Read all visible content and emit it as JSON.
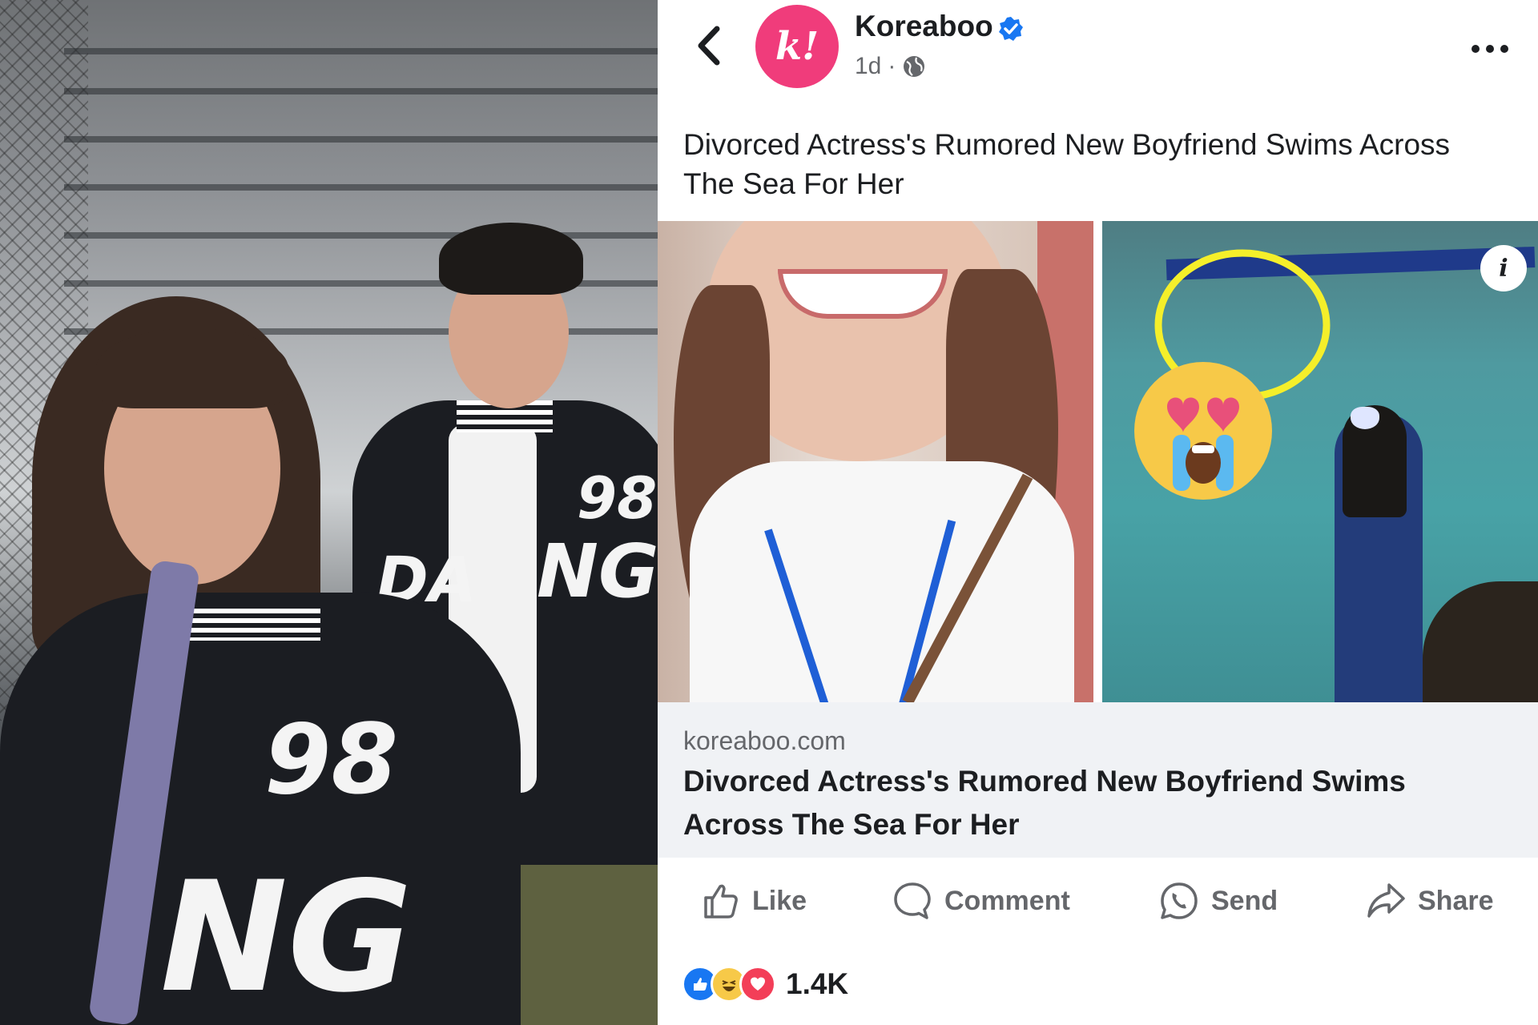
{
  "post": {
    "page_name": "Koreaboo",
    "avatar_text": "k!",
    "time_ago": "1d",
    "meta_separator": "·",
    "caption": "Divorced Actress's Rumored New Boyfriend Swims Across The Sea For Her",
    "link": {
      "domain": "koreaboo.com",
      "title": "Divorced Actress's Rumored New Boyfriend Swims Across The Sea For Her"
    },
    "info_label": "i",
    "actions": {
      "like": "Like",
      "comment": "Comment",
      "send": "Send",
      "share": "Share"
    },
    "reaction_count": "1.4K"
  },
  "left_photo": {
    "jacket_number": "98",
    "jacket_text_1": "DA",
    "jacket_text_2": "NG"
  },
  "colors": {
    "brand": "#f03c7b",
    "verified": "#1877f2",
    "text_primary": "#1c1e21",
    "text_secondary": "#65676b",
    "link_card_bg": "#f0f2f5",
    "highlight_circle": "#f5ef2a"
  },
  "icons": [
    "back-arrow-icon",
    "verified-badge-icon",
    "globe-icon",
    "more-dots-icon",
    "info-icon",
    "like-icon",
    "comment-icon",
    "send-icon",
    "share-icon",
    "like-reaction-icon",
    "haha-reaction-icon",
    "love-reaction-icon",
    "heart-eyes-crying-emoji"
  ]
}
